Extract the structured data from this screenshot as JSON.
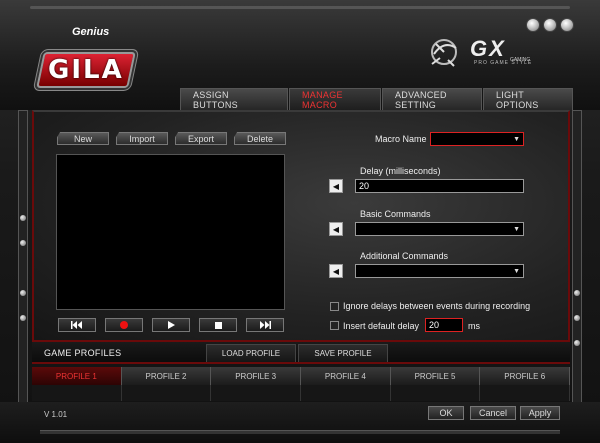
{
  "header": {
    "brand": "Genius",
    "product_logo": "GILA",
    "gx_logo": "GX",
    "gx_gaming": "GAMING",
    "gx_tagline": "PRO GAME STYLE"
  },
  "tabs": [
    {
      "label": "ASSIGN BUTTONS",
      "active": false
    },
    {
      "label": "MANAGE MACRO",
      "active": true
    },
    {
      "label": "ADVANCED SETTING",
      "active": false
    },
    {
      "label": "LIGHT OPTIONS",
      "active": false
    }
  ],
  "macro_toolbar": {
    "new_label": "New",
    "import_label": "Import",
    "export_label": "Export",
    "delete_label": "Delete"
  },
  "macro_settings": {
    "macro_name_label": "Macro Name",
    "macro_name_value": "",
    "delay_label": "Delay (milliseconds)",
    "delay_value": "20",
    "basic_commands_label": "Basic Commands",
    "basic_commands_value": "",
    "additional_commands_label": "Additional Commands",
    "additional_commands_value": "",
    "ignore_delays_label": "Ignore delays between events during recording",
    "insert_default_delay_label": "Insert default delay",
    "default_delay_value": "20",
    "default_delay_unit": "ms"
  },
  "game_profiles": {
    "title": "GAME PROFILES",
    "load_label": "LOAD PROFILE",
    "save_label": "SAVE PROFILE",
    "profiles": [
      {
        "label": "PROFILE 1",
        "active": true
      },
      {
        "label": "PROFILE 2",
        "active": false
      },
      {
        "label": "PROFILE 3",
        "active": false
      },
      {
        "label": "PROFILE 4",
        "active": false
      },
      {
        "label": "PROFILE 5",
        "active": false
      },
      {
        "label": "PROFILE 6",
        "active": false
      }
    ]
  },
  "footer": {
    "version": "V 1.01",
    "ok_label": "OK",
    "cancel_label": "Cancel",
    "apply_label": "Apply"
  },
  "icons": {
    "rewind": "rewind-icon",
    "record": "record-icon",
    "play": "play-icon",
    "stop": "stop-icon",
    "fast_forward": "fast-forward-icon",
    "move_left": "arrow-left-icon",
    "dropdown": "chevron-down-icon"
  },
  "colors": {
    "accent_red": "#dd2222",
    "active_tab_text": "#ee3333",
    "panel_border": "#6a0a0a"
  }
}
